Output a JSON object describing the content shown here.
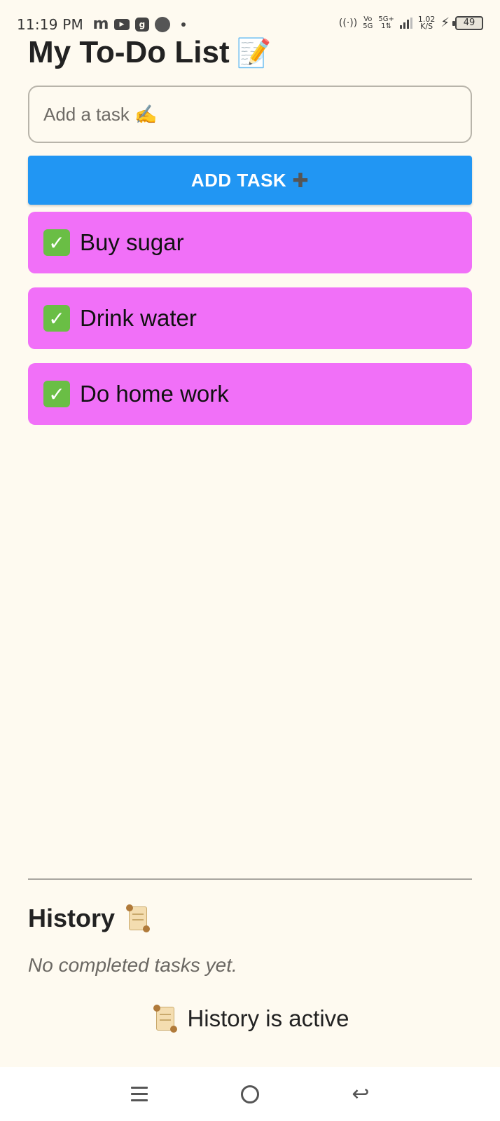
{
  "status_bar": {
    "time": "11:19 PM",
    "net_top": "Vo",
    "net_bottom": "5G",
    "net2_top": "5G+",
    "net2_bottom": "1⇅",
    "speed_value": "1.02",
    "speed_unit": "K/S",
    "battery": "49"
  },
  "header": {
    "title": "My To-Do List",
    "title_emoji": "📝"
  },
  "task_input": {
    "placeholder": "Add a task ✍️",
    "value": ""
  },
  "add_button": {
    "label": "ADD TASK",
    "icon": "plus-icon"
  },
  "tasks": [
    {
      "label": "Buy sugar",
      "done": true
    },
    {
      "label": "Drink water",
      "done": true
    },
    {
      "label": "Do home work",
      "done": true
    }
  ],
  "history": {
    "title": "History",
    "empty_text": "No completed tasks yet.",
    "active_text": "History is active"
  },
  "colors": {
    "background": "#fefaf0",
    "button": "#2196f3",
    "task": "#f170f8",
    "check": "#6abe45"
  }
}
